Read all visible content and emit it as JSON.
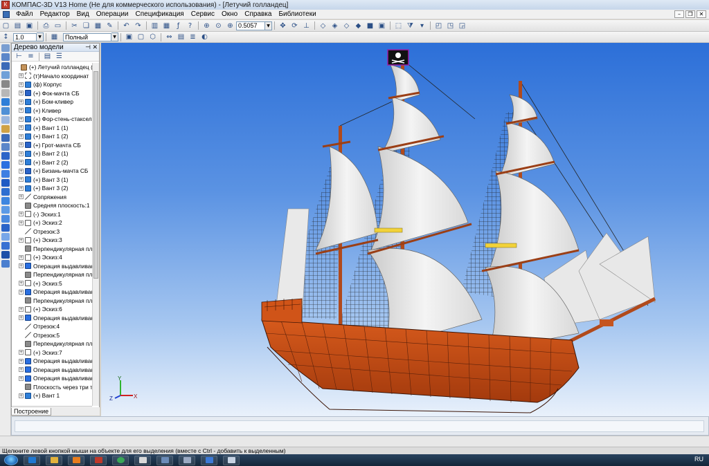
{
  "window": {
    "title": "КОМПАС-3D V13 Home (Не для коммерческого использования) - [Летучий голландец]"
  },
  "menu": {
    "items": [
      "Файл",
      "Редактор",
      "Вид",
      "Операции",
      "Спецификация",
      "Сервис",
      "Окно",
      "Справка",
      "Библиотеки"
    ]
  },
  "toolbar": {
    "zoom_value": "0.5057",
    "step_value": "1.0",
    "display_mode": "Полный",
    "icons": [
      "new-file-icon",
      "open-icon",
      "save-icon",
      "print-icon",
      "preview-icon",
      "cut-icon",
      "copy-icon",
      "paste-icon",
      "properties-icon",
      "undo-icon",
      "redo-icon",
      "manager-icon",
      "variables-icon",
      "function-icon",
      "help-icon",
      "zoom-window-icon",
      "zoom-icon",
      "pan-icon",
      "rotate-icon",
      "orient-icon",
      "wireframe-icon",
      "hidden-icon",
      "shaded-icon",
      "perspective-icon"
    ]
  },
  "model_tree": {
    "title": "Дерево модели",
    "items": [
      {
        "label": "(+) Летучий голландец (Те",
        "icon": "root",
        "exp": false
      },
      {
        "label": "(т)Начало координат",
        "icon": "axis",
        "exp": true
      },
      {
        "label": "(ф) Корпус",
        "icon": "part",
        "exp": true
      },
      {
        "label": "(+) Фок-мачта СБ",
        "icon": "asm",
        "exp": true
      },
      {
        "label": "(+) Бом-кливер",
        "icon": "part",
        "exp": true
      },
      {
        "label": "(+) Кливер",
        "icon": "part",
        "exp": true
      },
      {
        "label": "(+) Фор-стень-стаксел",
        "icon": "part",
        "exp": true
      },
      {
        "label": "(+) Вант 1 (1)",
        "icon": "part",
        "exp": true
      },
      {
        "label": "(+) Вант 1 (2)",
        "icon": "part",
        "exp": true
      },
      {
        "label": "(+) Грот-мачта СБ",
        "icon": "asm",
        "exp": true
      },
      {
        "label": "(+) Вант 2 (1)",
        "icon": "part",
        "exp": true
      },
      {
        "label": "(+) Вант 2 (2)",
        "icon": "part",
        "exp": true
      },
      {
        "label": "(+) Бизань-мачта СБ",
        "icon": "asm",
        "exp": true
      },
      {
        "label": "(+) Вант 3 (1)",
        "icon": "part",
        "exp": true
      },
      {
        "label": "(+) Вант 3 (2)",
        "icon": "part",
        "exp": true
      },
      {
        "label": "Сопряжения",
        "icon": "line",
        "exp": true
      },
      {
        "label": "Средняя плоскость:1",
        "icon": "gray",
        "exp": false
      },
      {
        "label": "(-) Эскиз:1",
        "icon": "sketch",
        "exp": true
      },
      {
        "label": "(+) Эскиз:2",
        "icon": "sketch",
        "exp": true
      },
      {
        "label": "Отрезок:3",
        "icon": "line",
        "exp": false
      },
      {
        "label": "(+) Эскиз:3",
        "icon": "sketch",
        "exp": true
      },
      {
        "label": "Перпендикулярная пл",
        "icon": "gray",
        "exp": false
      },
      {
        "label": "(+) Эскиз:4",
        "icon": "sketch",
        "exp": true
      },
      {
        "label": "Операция выдавливан",
        "icon": "op",
        "exp": true
      },
      {
        "label": "Перпендикулярная пл",
        "icon": "gray",
        "exp": false
      },
      {
        "label": "(+) Эскиз:5",
        "icon": "sketch",
        "exp": true
      },
      {
        "label": "Операция выдавливан",
        "icon": "op",
        "exp": true
      },
      {
        "label": "Перпендикулярная пл",
        "icon": "gray",
        "exp": false
      },
      {
        "label": "(+) Эскиз:6",
        "icon": "sketch",
        "exp": true
      },
      {
        "label": "Операция выдавливан",
        "icon": "op",
        "exp": true
      },
      {
        "label": "Отрезок:4",
        "icon": "line",
        "exp": false
      },
      {
        "label": "Отрезок:5",
        "icon": "line",
        "exp": false
      },
      {
        "label": "Перпендикулярная пл",
        "icon": "gray",
        "exp": false
      },
      {
        "label": "(+) Эскиз:7",
        "icon": "sketch",
        "exp": true
      },
      {
        "label": "Операция выдавливан",
        "icon": "op",
        "exp": true
      },
      {
        "label": "Операция выдавливан",
        "icon": "op",
        "exp": true
      },
      {
        "label": "Операция выдавливан",
        "icon": "op",
        "exp": true
      },
      {
        "label": "Плоскость через три т",
        "icon": "gray",
        "exp": false
      },
      {
        "label": "(+) Вант 1",
        "icon": "part",
        "exp": true
      }
    ]
  },
  "tabs": {
    "build": "Построение"
  },
  "axes": {
    "x": "X",
    "y": "Y",
    "z": "Z"
  },
  "status": {
    "hint": "Щелкните левой кнопкой мыши на объекте для его выделения (вместе с Ctrl - добавить к выделенным)"
  },
  "taskbar": {
    "lang": "RU",
    "items": [
      "explorer-icon",
      "media-icon",
      "kompas-icon",
      "chrome-icon",
      "app-icon",
      "app2-icon",
      "app3-icon",
      "app4-icon",
      "app5-icon",
      "app6-icon"
    ]
  },
  "colors": {
    "hull": "#c94a14",
    "sail": "#ececec",
    "accent": "#2f6fd8"
  }
}
